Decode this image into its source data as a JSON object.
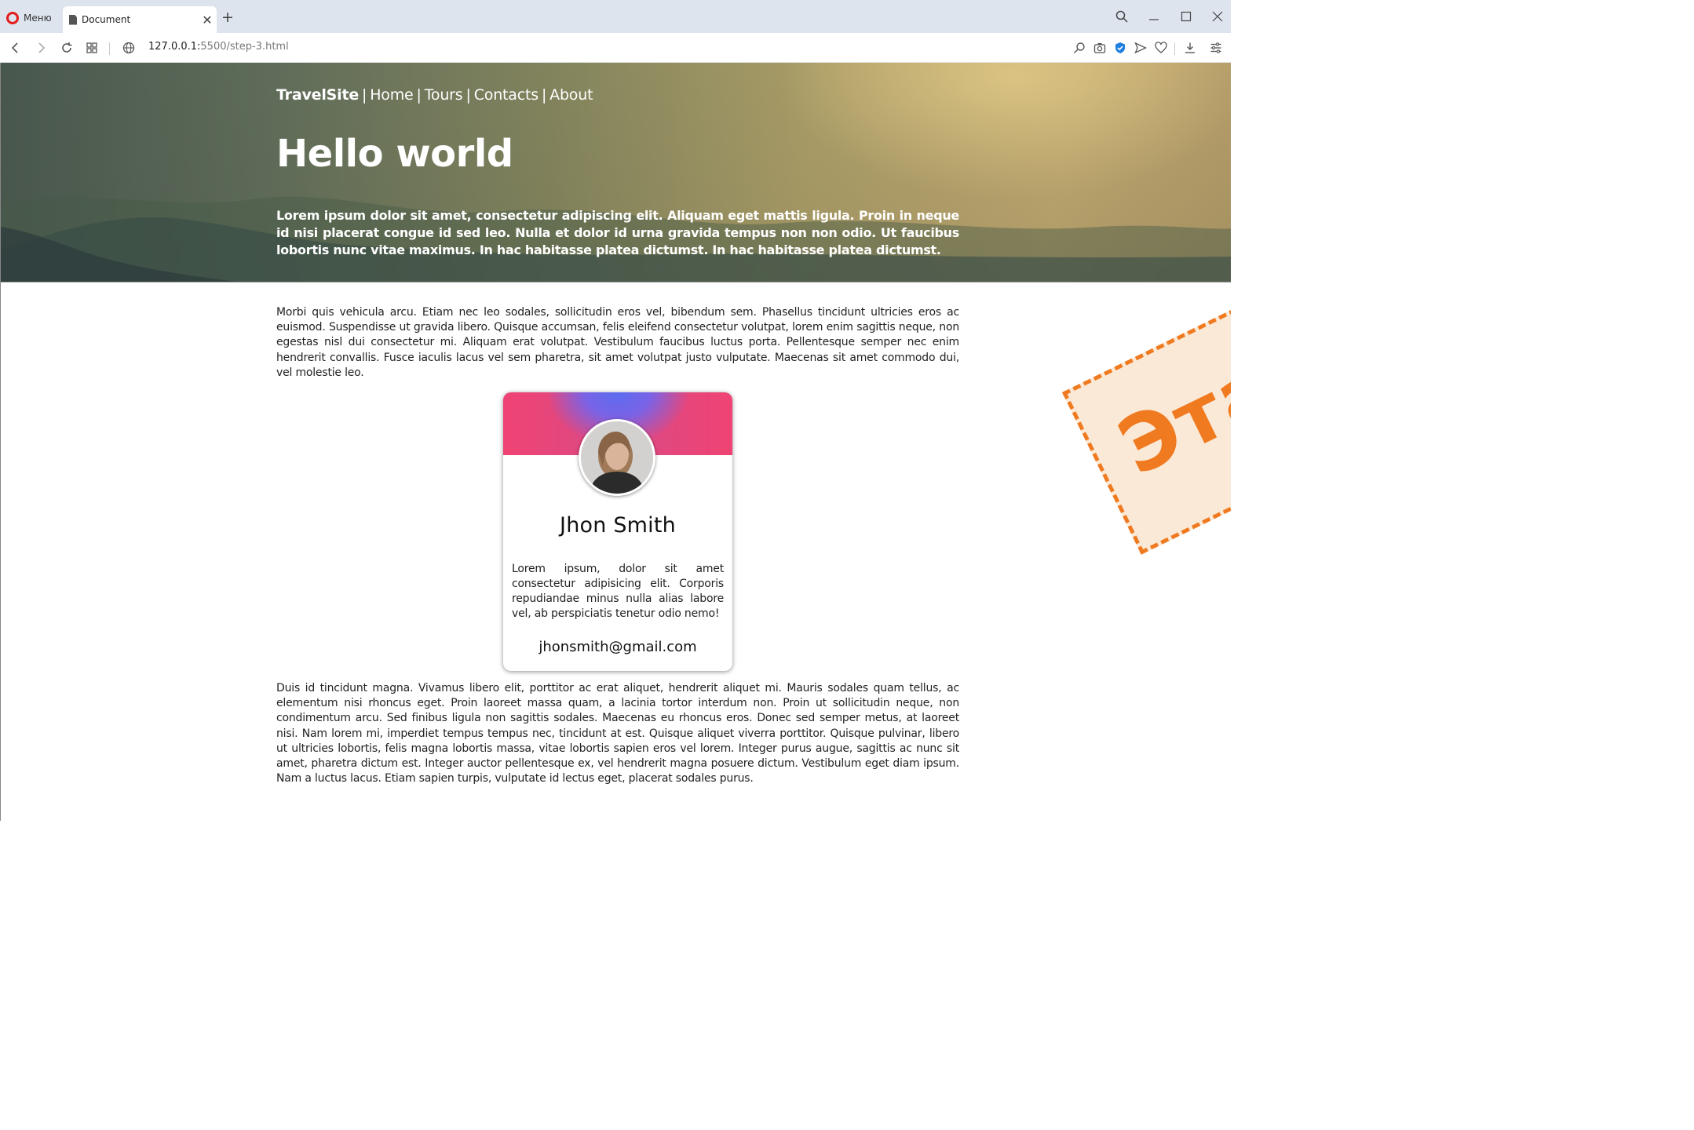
{
  "browser": {
    "menu_label": "Меню",
    "tab_title": "Document",
    "url_host": "127.0.0.1:",
    "url_path": "5500/step-3.html"
  },
  "nav": {
    "brand": "TravelSite",
    "separator": "|",
    "items": [
      "Home",
      "Tours",
      "Contacts",
      "About"
    ]
  },
  "hero": {
    "title": "Hello world",
    "lead": "Lorem ipsum dolor sit amet, consectetur adipiscing elit. Aliquam eget mattis ligula. Proin in neque id nisi placerat congue id sed leo. Nulla et dolor id urna gravida tempus non non odio. Ut faucibus lobortis nunc vitae maximus. In hac habitasse platea dictumst. In hac habitasse platea dictumst."
  },
  "content": {
    "paragraph_1": "Morbi quis vehicula arcu. Etiam nec leo sodales, sollicitudin eros vel, bibendum sem. Phasellus tincidunt ultricies eros ac euismod. Suspendisse ut gravida libero. Quisque accumsan, felis eleifend consectetur volutpat, lorem enim sagittis neque, non egestas nisl dui consectetur mi. Aliquam erat volutpat. Vestibulum faucibus luctus porta. Pellentesque semper nec enim hendrerit convallis. Fusce iaculis lacus vel sem pharetra, sit amet volutpat justo vulputate. Maecenas sit amet commodo dui, vel molestie leo.",
    "paragraph_2": "Duis id tincidunt magna. Vivamus libero elit, porttitor ac erat aliquet, hendrerit aliquet mi. Mauris sodales quam tellus, ac elementum nisi rhoncus eget. Proin laoreet massa quam, a lacinia tortor interdum non. Proin ut sollicitudin neque, non condimentum arcu. Sed finibus ligula non sagittis sodales. Maecenas eu rhoncus eros. Donec sed semper metus, at laoreet nisi. Nam lorem mi, imperdiet tempus tempus nec, tincidunt at est. Quisque aliquet viverra porttitor. Quisque pulvinar, libero ut ultricies lobortis, felis magna lobortis massa, vitae lobortis sapien eros vel lorem. Integer purus augue, sagittis ac nunc sit amet, pharetra dictum est. Integer auctor pellentesque ex, vel hendrerit magna posuere dictum. Vestibulum eget diam ipsum. Nam a luctus lacus. Etiam sapien turpis, vulputate id lectus eget, placerat sodales purus."
  },
  "card": {
    "name": "Jhon Smith",
    "bio": "Lorem ipsum, dolor sit amet consectetur adipisicing elit. Corporis repudiandae minus nulla alias labore vel, ab perspiciatis tenetur odio nemo!",
    "email": "jhonsmith@gmail.com"
  },
  "stamp": {
    "text": "Этап"
  },
  "colors": {
    "card_gradient_pink": "#ef4373",
    "card_gradient_blue": "#5b6cf0",
    "stamp_orange": "#f07a20",
    "opera_red": "#e31c1c"
  }
}
